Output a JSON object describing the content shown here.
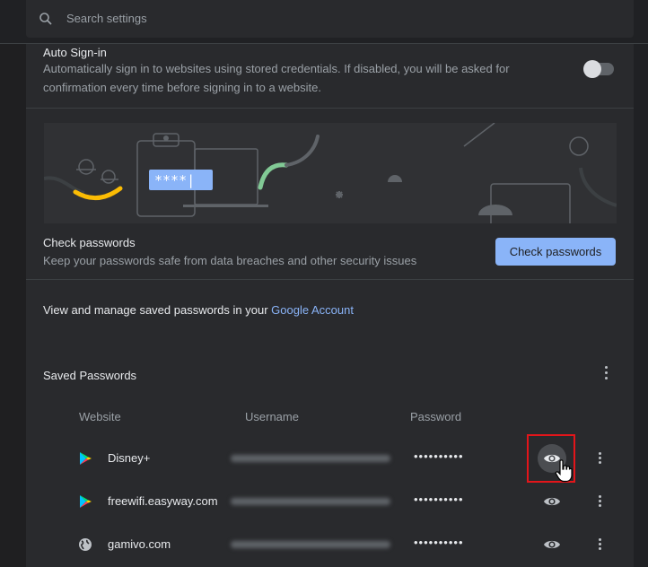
{
  "search": {
    "placeholder": "Search settings"
  },
  "auto_signin": {
    "title": "Auto Sign-in",
    "description_line1": "Automatically sign in to websites using stored credentials. If disabled, you will be asked for",
    "description_line2": "confirmation every time before signing in to a website.",
    "enabled": false
  },
  "check_passwords": {
    "title": "Check passwords",
    "description": "Keep your passwords safe from data breaches and other security issues",
    "button_label": "Check passwords",
    "banner_password_text": "****|"
  },
  "manage": {
    "text": "View and manage saved passwords in your ",
    "link": "Google Account"
  },
  "saved_passwords": {
    "title": "Saved Passwords",
    "columns": {
      "website": "Website",
      "username": "Username",
      "password": "Password"
    },
    "rows": [
      {
        "site": "Disney+",
        "icon": "play-store-icon",
        "password": "••••••••••"
      },
      {
        "site": "freewifi.easyway.com",
        "icon": "play-store-icon",
        "password": "••••••••••"
      },
      {
        "site": "gamivo.com",
        "icon": "globe-icon",
        "password": "••••••••••"
      }
    ]
  },
  "colors": {
    "accent": "#8ab4f8",
    "highlight": "#e3151a",
    "toggle_off": "#5f6368"
  }
}
